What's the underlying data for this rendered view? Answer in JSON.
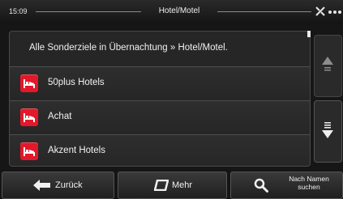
{
  "status_bar": {
    "time": "15:09",
    "title": "Hotel/Motel",
    "icons": [
      "satellite-icon",
      "signal-dots-icon"
    ]
  },
  "list": {
    "header": "Alle Sonderziele in Übernachtung » Hotel/Motel.",
    "items": [
      {
        "label": "50plus Hotels",
        "icon": "bed-icon"
      },
      {
        "label": "Achat",
        "icon": "bed-icon"
      },
      {
        "label": "Akzent Hotels",
        "icon": "bed-icon"
      }
    ]
  },
  "scroll": {
    "up_icon": "scroll-up-arrow-icon",
    "down_icon": "scroll-down-arrow-icon"
  },
  "bottom_bar": {
    "back_label": "Zurück",
    "more_label": "Mehr",
    "search_label_line1": "Nach Namen",
    "search_label_line2": "suchen"
  },
  "colors": {
    "accent_red": "#e3182a",
    "background": "#161616",
    "panel": "#2b2b2b"
  }
}
